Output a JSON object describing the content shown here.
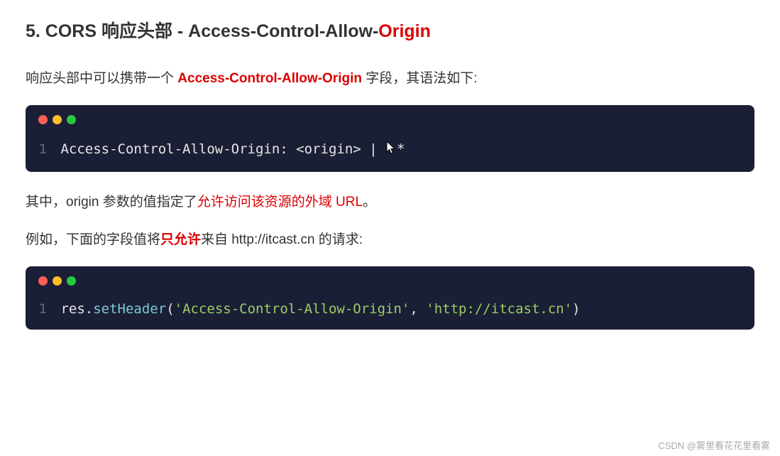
{
  "heading": {
    "prefix": "5. CORS 响应头部 - Access-Control-Allow-",
    "highlight": "Origin"
  },
  "para1": {
    "before": "响应头部中可以携带一个 ",
    "bold": "Access-Control-Allow-Origin",
    "after": " 字段，其语法如下:"
  },
  "codeblock1": {
    "line_num": "1",
    "code": "Access-Control-Allow-Origin: <origin> | ",
    "code_tail": "*"
  },
  "para2": {
    "before": "其中，origin 参数的值指定了",
    "red": "允许访问该资源的外域 URL",
    "after": "。"
  },
  "para3": {
    "before": "例如，下面的字段值将",
    "bold": "只允许",
    "after": "来自 http://itcast.cn 的请求:"
  },
  "codeblock2": {
    "line_num": "1",
    "obj": "res",
    "dot": ".",
    "method": "setHeader",
    "open": "(",
    "str1": "'Access-Control-Allow-Origin'",
    "comma": ", ",
    "str2": "'http://itcast.cn'",
    "close": ")"
  },
  "watermark": "CSDN @雾里看花花里看雾"
}
